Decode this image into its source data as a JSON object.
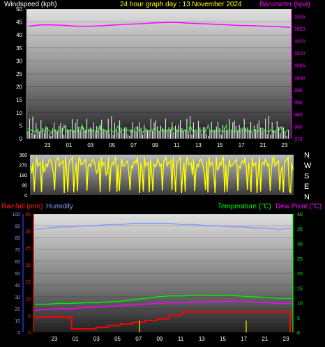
{
  "header": {
    "left_title": "Windspeed (kph)",
    "center_title": "24 hour graph day : 13 November 2024",
    "right_title": "Barometer (hpa)"
  },
  "wind_dir_labels": [
    "N",
    "W",
    "S",
    "E",
    "N"
  ],
  "bottom_header": {
    "rainfall": "Rainfall (mm)",
    "humidity": "Humidity",
    "temperature": "Temperature (°C)",
    "dewpoint": "Dew Point (°C)"
  },
  "colors": {
    "windspeed": "#ffffff",
    "gust": "#c8c8c8",
    "avg_wind": "#33ff33",
    "barometer": "#ff00ff",
    "wind_dir": "#ffff00",
    "rainfall": "#ff0000",
    "humidity": "#8899ff",
    "temperature": "#00ff00",
    "dewpoint": "#ff00ff",
    "title_yellow": "#ffff00"
  },
  "chart_data": [
    {
      "type": "line",
      "name": "windspeed_barometer",
      "x_ticks": [
        "23",
        "01",
        "03",
        "05",
        "07",
        "09",
        "11",
        "13",
        "15",
        "17",
        "21",
        "23"
      ],
      "y_left_ticks": [
        0,
        5,
        10,
        15,
        20,
        25,
        30,
        35,
        40,
        45,
        50
      ],
      "y_right_ticks": [
        975,
        980,
        985,
        990,
        995,
        1000,
        1005,
        1010,
        1015,
        1020,
        1025
      ],
      "ylim_left": [
        0,
        50
      ],
      "ylim_right": [
        975,
        1028
      ],
      "series": [
        {
          "name": "Windspeed (kph)",
          "axis": "left",
          "values": [
            5,
            7,
            3,
            8,
            2,
            6,
            4,
            3,
            7,
            5,
            2,
            6,
            4,
            3,
            1,
            5,
            6,
            4,
            3,
            5,
            7,
            4,
            2,
            5,
            6,
            3,
            5,
            7,
            4,
            6,
            8,
            5,
            3,
            6,
            4,
            5,
            7,
            6,
            4,
            5,
            6,
            3,
            5,
            4,
            6,
            7,
            5,
            3
          ]
        },
        {
          "name": "Barometer (hpa)",
          "axis": "right",
          "values": [
            1021,
            1021.5,
            1021.5,
            1021.3,
            1021,
            1021,
            1021.2,
            1021.5,
            1021.8,
            1022,
            1022.3,
            1022.5,
            1022.5,
            1022.2,
            1022,
            1021.8,
            1021.5,
            1021.3,
            1021.2,
            1021,
            1020.8,
            1020.5
          ]
        }
      ]
    },
    {
      "type": "line",
      "name": "wind_direction",
      "y_ticks": [
        0,
        90,
        180,
        270,
        360
      ],
      "ylim": [
        0,
        360
      ]
    },
    {
      "type": "line",
      "name": "rain_humidity_temp_dew",
      "x_ticks": [
        "23",
        "01",
        "03",
        "05",
        "07",
        "09",
        "11",
        "13",
        "15",
        "17",
        "21",
        "23"
      ],
      "y_left_ticks": [
        0,
        10,
        20,
        30,
        40,
        50,
        60,
        70,
        80,
        90,
        100
      ],
      "y_rain_ticks": [
        0,
        5,
        10,
        15,
        20,
        25,
        30,
        35
      ],
      "y_right_ticks": [
        0,
        5,
        10,
        15,
        20,
        25,
        30,
        35,
        40
      ],
      "series": [
        {
          "name": "Humidity",
          "axis": "left",
          "values": [
            87,
            88,
            89,
            89,
            90,
            90,
            91,
            91,
            92,
            92,
            92,
            92,
            91,
            91,
            90,
            90,
            89,
            89,
            88,
            88,
            87,
            88
          ]
        },
        {
          "name": "Temperature (°C)",
          "axis": "right",
          "values": [
            9.5,
            9.5,
            9.8,
            9.8,
            10,
            10,
            10.3,
            10.5,
            11,
            11.5,
            12,
            12.3,
            12.3,
            12.5,
            12.5,
            12.4,
            12.5,
            12.2,
            12,
            11.8,
            11.5,
            11.5
          ]
        },
        {
          "name": "Dew Point (°C)",
          "axis": "right",
          "values": [
            7.5,
            7.8,
            8,
            8,
            8.3,
            8.5,
            8.8,
            9,
            9.3,
            9.5,
            9.8,
            10,
            10,
            10.2,
            10.3,
            10.3,
            10.5,
            10.3,
            10.2,
            10,
            9.8,
            9.8
          ]
        },
        {
          "name": "Rainfall (mm)",
          "axis": "rain",
          "values": [
            4.5,
            4.5,
            4.5,
            1,
            1,
            1.5,
            2,
            2.5,
            3,
            3.5,
            4,
            5,
            6,
            6,
            6,
            6,
            6,
            6,
            6,
            6,
            6,
            6
          ]
        }
      ]
    }
  ]
}
